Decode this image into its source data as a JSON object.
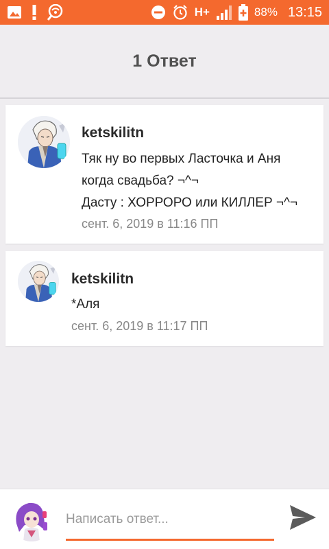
{
  "status_bar": {
    "network": "H+",
    "battery": "88%",
    "time": "13:15",
    "icons": [
      "image-icon",
      "alert-icon",
      "wifi-search-icon",
      "do-not-disturb-icon",
      "alarm-icon",
      "signal-icon",
      "battery-icon"
    ],
    "color": "#f4692e"
  },
  "header": {
    "title": "1 Ответ"
  },
  "comments": [
    {
      "author": "ketskilitn",
      "lines": [
        "Тяк ну во первых Ласточка и Аня",
        "когда свадьба? ¬^¬",
        "Дасту : ХОРРОРО или КИЛЛЕР ¬^¬"
      ],
      "timestamp": "сент. 6, 2019 в 11:16 ПП"
    },
    {
      "author": "ketskilitn",
      "lines": [
        "*Аля"
      ],
      "timestamp": "сент. 6, 2019 в 11:17 ПП"
    }
  ],
  "composer": {
    "placeholder": "Написать ответ...",
    "send_icon": "send-icon",
    "accent": "#f4692e"
  }
}
